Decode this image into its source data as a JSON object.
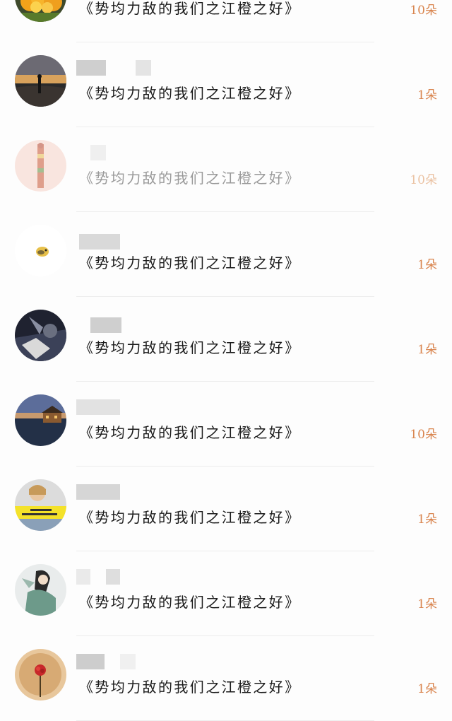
{
  "rewards": [
    {
      "title": "《势均力敌的我们之江橙之好》",
      "flowers": "10朵",
      "avatar_icon": "flower-avatar",
      "faded": false
    },
    {
      "title": "《势均力敌的我们之江橙之好》",
      "flowers": "1朵",
      "avatar_icon": "sunset-silhouette-avatar",
      "faded": false
    },
    {
      "title": "《势均力敌的我们之江橙之好》",
      "flowers": "10朵",
      "avatar_icon": "pencil-avatar",
      "faded": true
    },
    {
      "title": "《势均力敌的我们之江橙之好》",
      "flowers": "1朵",
      "avatar_icon": "small-bird-avatar",
      "faded": false
    },
    {
      "title": "《势均力敌的我们之江橙之好》",
      "flowers": "1朵",
      "avatar_icon": "dark-figure-avatar",
      "faded": false
    },
    {
      "title": "《势均力敌的我们之江橙之好》",
      "flowers": "10朵",
      "avatar_icon": "lake-house-avatar",
      "faded": false
    },
    {
      "title": "《势均力敌的我们之江橙之好》",
      "flowers": "1朵",
      "avatar_icon": "girl-car-avatar",
      "faded": false
    },
    {
      "title": "《势均力敌的我们之江橙之好》",
      "flowers": "1朵",
      "avatar_icon": "anime-figure-avatar",
      "faded": false
    },
    {
      "title": "《势均力敌的我们之江橙之好》",
      "flowers": "1朵",
      "avatar_icon": "red-flower-avatar",
      "faded": false
    }
  ],
  "colors": {
    "flower_count": "#d9854f",
    "divider": "#ededed",
    "background": "#fdfdfd"
  }
}
